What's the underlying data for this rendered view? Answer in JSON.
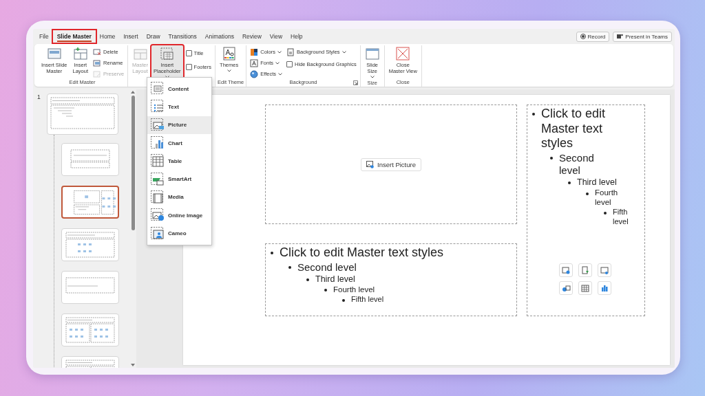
{
  "tabs": [
    {
      "label": "File",
      "selected": false,
      "highlighted": false
    },
    {
      "label": "Slide Master",
      "selected": true,
      "highlighted": true
    },
    {
      "label": "Home",
      "selected": false,
      "highlighted": false
    },
    {
      "label": "Insert",
      "selected": false,
      "highlighted": false
    },
    {
      "label": "Draw",
      "selected": false,
      "highlighted": false
    },
    {
      "label": "Transitions",
      "selected": false,
      "highlighted": false
    },
    {
      "label": "Animations",
      "selected": false,
      "highlighted": false
    },
    {
      "label": "Review",
      "selected": false,
      "highlighted": false
    },
    {
      "label": "View",
      "selected": false,
      "highlighted": false
    },
    {
      "label": "Help",
      "selected": false,
      "highlighted": false
    }
  ],
  "header_buttons": [
    {
      "kind": "record",
      "label": "Record"
    },
    {
      "kind": "teams",
      "label": "Present in Teams"
    }
  ],
  "ribbon": {
    "groups": [
      {
        "label": "Edit Master",
        "items": [
          {
            "kind": "large",
            "label": "Insert Slide\nMaster",
            "disabled": false,
            "menu": false,
            "highlighted": false
          },
          {
            "kind": "large",
            "label": "Insert\nLayout",
            "disabled": false,
            "menu": false,
            "highlighted": false
          },
          {
            "kind": "stack",
            "items": [
              {
                "kind": "small",
                "label": "Delete",
                "disabled": false,
                "menu": false
              },
              {
                "kind": "small",
                "label": "Rename",
                "disabled": false,
                "menu": false
              },
              {
                "kind": "small",
                "label": "Preserve",
                "disabled": true,
                "menu": false
              }
            ]
          }
        ]
      },
      {
        "items": [
          {
            "kind": "large",
            "label": "Master\nLayout",
            "disabled": true,
            "menu": false,
            "highlighted": false
          },
          {
            "kind": "large",
            "label": "Insert\nPlaceholder",
            "disabled": false,
            "menu": true,
            "highlighted": true
          },
          {
            "kind": "stack",
            "items": [
              {
                "kind": "check",
                "label": "Title",
                "checked": false
              },
              {
                "kind": "check",
                "label": "Footers",
                "checked": false
              }
            ]
          }
        ]
      },
      {
        "label": "Edit Theme",
        "items": [
          {
            "kind": "large",
            "label": "Themes",
            "disabled": false,
            "menu": true,
            "highlighted": false
          }
        ]
      },
      {
        "label": "Background",
        "launcher": true,
        "items": [
          {
            "kind": "stack",
            "items": [
              {
                "kind": "small",
                "label": "Colors",
                "disabled": false,
                "menu": true
              },
              {
                "kind": "small",
                "label": "Fonts",
                "disabled": false,
                "menu": true
              },
              {
                "kind": "small",
                "label": "Effects",
                "disabled": false,
                "menu": true
              }
            ]
          },
          {
            "kind": "stack",
            "items": [
              {
                "kind": "small",
                "label": "Background Styles",
                "disabled": false,
                "menu": true
              },
              {
                "kind": "check",
                "label": "Hide Background Graphics",
                "checked": false
              }
            ]
          }
        ]
      },
      {
        "label": "Size",
        "items": [
          {
            "kind": "large",
            "label": "Slide\nSize",
            "disabled": false,
            "menu": true,
            "highlighted": false
          }
        ]
      },
      {
        "label": "Close",
        "items": [
          {
            "kind": "large",
            "label": "Close\nMaster View",
            "disabled": false,
            "menu": false,
            "highlighted": false
          }
        ]
      }
    ]
  },
  "thumbnails": {
    "slide_number": "1",
    "master": {
      "kind": "master",
      "selected": false
    },
    "layouts": [
      {
        "kind": "title",
        "selected": false
      },
      {
        "kind": "picture",
        "selected": true
      },
      {
        "kind": "content",
        "selected": false
      },
      {
        "kind": "heading",
        "selected": false
      },
      {
        "kind": "twin",
        "selected": false
      },
      {
        "kind": "comparison",
        "selected": false
      }
    ]
  },
  "placeholder_menu": {
    "items": [
      {
        "label": "Content",
        "selected": false
      },
      {
        "label": "Text",
        "selected": false
      },
      {
        "label": "Picture",
        "selected": true
      },
      {
        "label": "Chart",
        "selected": false
      },
      {
        "label": "Table",
        "selected": false
      },
      {
        "label": "SmartArt",
        "selected": false
      },
      {
        "label": "Media",
        "selected": false
      },
      {
        "label": "Online Image",
        "selected": false
      },
      {
        "label": "Cameo",
        "selected": false
      }
    ]
  },
  "slide": {
    "picture_placeholder": {
      "button": "Insert Picture"
    },
    "body_placeholder": {
      "bullets": [
        {
          "text": "Click to edit Master text styles",
          "children": [
            {
              "text": "Second level",
              "children": [
                {
                  "text": "Third level",
                  "children": [
                    {
                      "text": "Fourth level",
                      "children": [
                        {
                          "text": "Fifth level"
                        }
                      ]
                    }
                  ]
                }
              ]
            }
          ]
        }
      ]
    },
    "content_placeholder": {
      "bullets": [
        {
          "text": "Click to edit Master text styles",
          "children": [
            {
              "text": "Second level",
              "children": [
                {
                  "text": "Third level",
                  "children": [
                    {
                      "text": "Fourth level",
                      "children": [
                        {
                          "text": "Fifth level"
                        }
                      ]
                    }
                  ]
                }
              ]
            }
          ]
        }
      ]
    }
  }
}
